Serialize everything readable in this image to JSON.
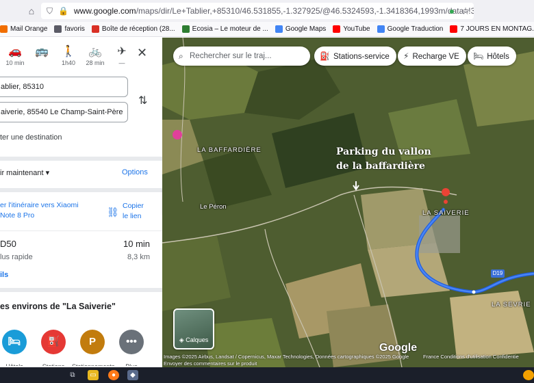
{
  "browser": {
    "url_host": "www.google.com",
    "url_path": "/maps/dir/Le+Tablier,+85310/46.531855,-1.327925/@46.5324593,-1.3418364,1993m/data=!3m1"
  },
  "bookmarks": [
    {
      "label": "Mail Orange",
      "icon": "envelope-icon",
      "color": "#f16e00"
    },
    {
      "label": "favoris",
      "icon": "folder-icon",
      "color": "#5b5b66"
    },
    {
      "label": "Boîte de réception (28...",
      "icon": "gmail-icon",
      "color": "#d93025"
    },
    {
      "label": "Ecosia – Le moteur de ...",
      "icon": "ecosia-icon",
      "color": "#2e7d32"
    },
    {
      "label": "Google Maps",
      "icon": "google-icon",
      "color": "#4285f4"
    },
    {
      "label": "YouTube",
      "icon": "youtube-icon",
      "color": "#ff0000"
    },
    {
      "label": "Google Traduction",
      "icon": "translate-icon",
      "color": "#4285f4"
    },
    {
      "label": "7 JOURS EN MONTAG...",
      "icon": "youtube-icon",
      "color": "#ff0000"
    }
  ],
  "panel": {
    "modes": [
      {
        "icon": "car-icon",
        "glyph": "🚗",
        "label": "10 min"
      },
      {
        "icon": "bus-icon",
        "glyph": "🚌",
        "label": ""
      },
      {
        "icon": "walk-icon",
        "glyph": "🚶",
        "label": "1h40"
      },
      {
        "icon": "bike-icon",
        "glyph": "🚲",
        "label": "28 min"
      },
      {
        "icon": "plane-icon",
        "glyph": "✈",
        "label": "—"
      }
    ],
    "origin": "ablier, 85310",
    "destination": "aiverie, 85540 Le Champ-Saint-Père",
    "add_destination": "ter une destination",
    "depart_label": "ir maintenant",
    "options_label": "Options",
    "share_line1": "er l'itinéraire vers Xiaomi",
    "share_line2": "Note 8 Pro",
    "copy_line1": "Copier",
    "copy_line2": "le lien",
    "route_name": "D50",
    "route_time": "10 min",
    "route_sub": "lus rapide",
    "route_dist": "8,3 km",
    "details_label": "ils",
    "env_title": "es environs de \"La Saiverie\"",
    "nearby": [
      {
        "icon": "hotel-icon",
        "glyph": "🛏",
        "label": "Hôtels",
        "color": "#1a9cd8"
      },
      {
        "icon": "fuel-icon",
        "glyph": "⛽",
        "label": "Stations",
        "color": "#e53935"
      },
      {
        "icon": "parking-icon",
        "glyph": "P",
        "label": "Stationnements",
        "color": "#c27c0e"
      },
      {
        "icon": "more-icon",
        "glyph": "•••",
        "label": "Plus",
        "color": "#6a7179"
      }
    ]
  },
  "map": {
    "search_placeholder": "Rechercher sur le traj...",
    "chips": [
      {
        "icon": "fuel-icon",
        "glyph": "⛽",
        "label": "Stations-service"
      },
      {
        "icon": "ev-charge-icon",
        "glyph": "⚡",
        "label": "Recharge VE"
      },
      {
        "icon": "hotel-icon",
        "glyph": "🛏",
        "label": "Hôtels"
      }
    ],
    "places": {
      "baffardiere": "LA BAFFARDIÈRE",
      "peron": "Le Péron",
      "saiverie": "LA SAIVERIE",
      "sevrie": "LA SEVRIE"
    },
    "annotation_line1": "Parking du vallon",
    "annotation_line2": "de la baffardière",
    "road_label": "D19",
    "layers_label": "Calques",
    "logo": "Google",
    "attribution": "Images ©2025 Airbus, Landsat / Copernicus, Maxar Technologies, Données cartographiques ©2025 Google",
    "feedback": "Envoyer des commentaires sur le produit",
    "footer_links": "France    Conditions d'utilisation    Confidentie",
    "road_label_bottom": "D19"
  }
}
